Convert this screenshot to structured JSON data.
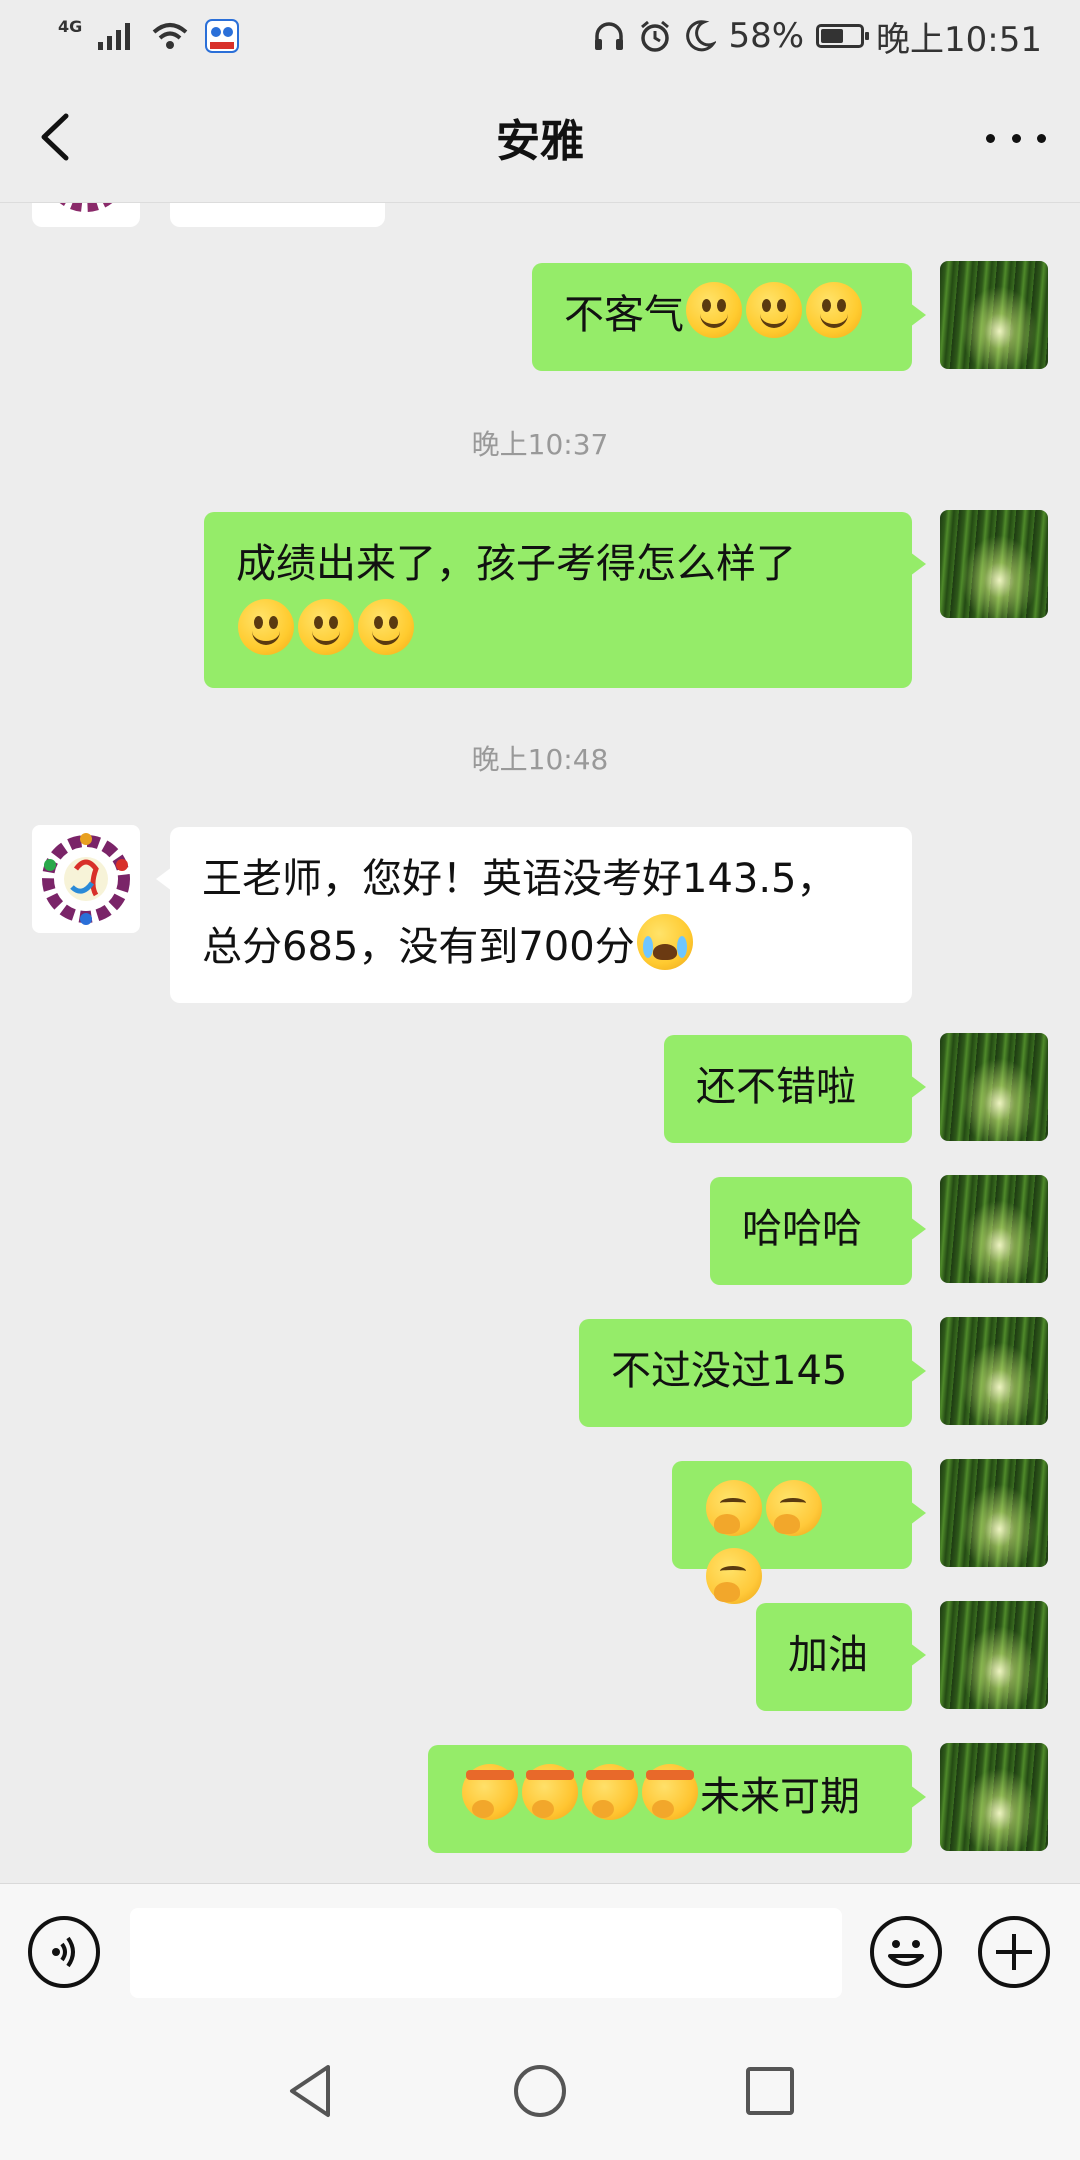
{
  "status_bar": {
    "network": "4G",
    "battery": "58%",
    "battery_level": 0.58,
    "time": "晚上10:51"
  },
  "header": {
    "title": "安雅"
  },
  "messages": [
    {
      "type": "time",
      "text": "晚上10:37"
    },
    {
      "type": "time",
      "text": "晚上10:48"
    }
  ],
  "bubbles": {
    "m1_text": "不客气",
    "m2_line1": "成绩出来了，孩子考得怎么样了",
    "m3_line1": "王老师，您好！英语没考好143.5，",
    "m3_line2": "总分685，没有到700分",
    "m4_text": "还不错啦",
    "m5_text": "哈哈哈",
    "m6_text": "不过没过145",
    "m7_text": "加油",
    "m8_text": "未来可期"
  },
  "emojis": {
    "smile": "smile-emoji",
    "cry": "cry-emoji",
    "think": "thinking-emoji",
    "fight": "fighting-emoji"
  },
  "input": {
    "placeholder": ""
  },
  "colors": {
    "my_bubble": "#95ec69",
    "other_bubble": "#ffffff",
    "background": "#ededed"
  }
}
